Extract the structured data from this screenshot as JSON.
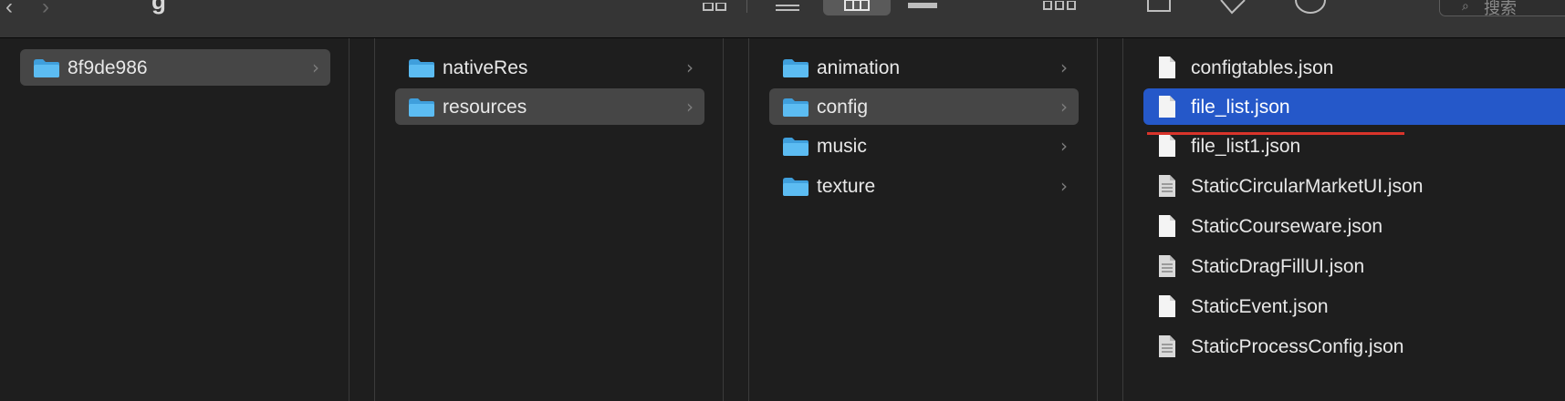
{
  "window": {
    "title_fragment": "g",
    "search_placeholder": "搜索",
    "back_chevron": "‹",
    "forward_chevron": "›"
  },
  "columns": [
    {
      "items": [
        {
          "label": "8f9de986",
          "kind": "folder",
          "state": "selected-inactive",
          "has_children": true
        }
      ]
    },
    {
      "items": [
        {
          "label": "nativeRes",
          "kind": "folder",
          "state": "normal",
          "has_children": true
        },
        {
          "label": "resources",
          "kind": "folder",
          "state": "selected-inactive",
          "has_children": true
        }
      ]
    },
    {
      "items": [
        {
          "label": "animation",
          "kind": "folder",
          "state": "normal",
          "has_children": true
        },
        {
          "label": "config",
          "kind": "folder",
          "state": "selected-inactive",
          "has_children": true
        },
        {
          "label": "music",
          "kind": "folder",
          "state": "normal",
          "has_children": true
        },
        {
          "label": "texture",
          "kind": "folder",
          "state": "normal",
          "has_children": true
        }
      ]
    },
    {
      "items": [
        {
          "label": "configtables.json",
          "kind": "file",
          "state": "normal"
        },
        {
          "label": "file_list.json",
          "kind": "file",
          "state": "selected-active"
        },
        {
          "label": "file_list1.json",
          "kind": "file",
          "state": "normal"
        },
        {
          "label": "StaticCircularMarketUI.json",
          "kind": "file",
          "state": "normal"
        },
        {
          "label": "StaticCourseware.json",
          "kind": "file",
          "state": "normal"
        },
        {
          "label": "StaticDragFillUI.json",
          "kind": "file",
          "state": "normal"
        },
        {
          "label": "StaticEvent.json",
          "kind": "file",
          "state": "normal"
        },
        {
          "label": "StaticProcessConfig.json",
          "kind": "file",
          "state": "normal"
        }
      ]
    }
  ],
  "chevron_glyph": "›",
  "colors": {
    "selection_blue": "#2558c9",
    "selection_gray": "#464646",
    "folder_blue": "#4fb2ee",
    "annotation_red": "#d9342b"
  }
}
